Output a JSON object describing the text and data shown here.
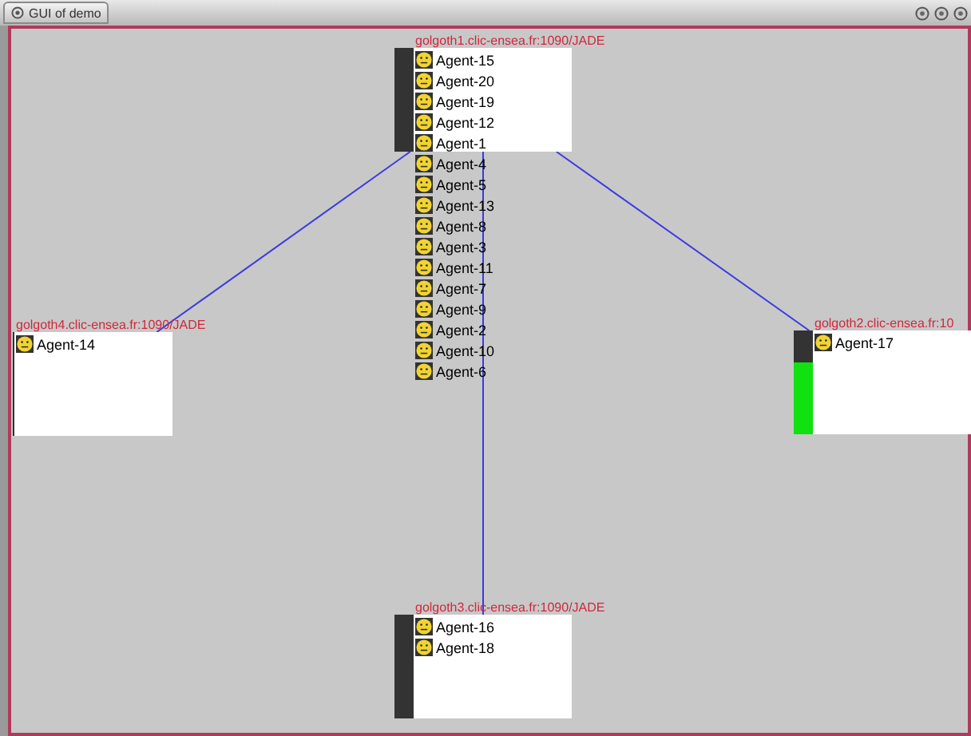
{
  "window": {
    "title": "GUI of demo"
  },
  "containers": [
    {
      "label": "golgoth1.clic-ensea.fr:1090/JADE",
      "agents": [
        "Agent-15",
        "Agent-20",
        "Agent-19",
        "Agent-12",
        "Agent-1",
        "Agent-4",
        "Agent-5",
        "Agent-13",
        "Agent-8",
        "Agent-3",
        "Agent-11",
        "Agent-7",
        "Agent-9",
        "Agent-2",
        "Agent-10",
        "Agent-6"
      ]
    },
    {
      "label": "golgoth4.clic-ensea.fr:1090/JADE",
      "agents": [
        "Agent-14"
      ]
    },
    {
      "label": "golgoth2.clic-ensea.fr:10",
      "agents": [
        "Agent-17"
      ],
      "level": 0.7
    },
    {
      "label": "golgoth3.clic-ensea.fr:1090/JADE",
      "agents": [
        "Agent-16",
        "Agent-18"
      ]
    }
  ]
}
